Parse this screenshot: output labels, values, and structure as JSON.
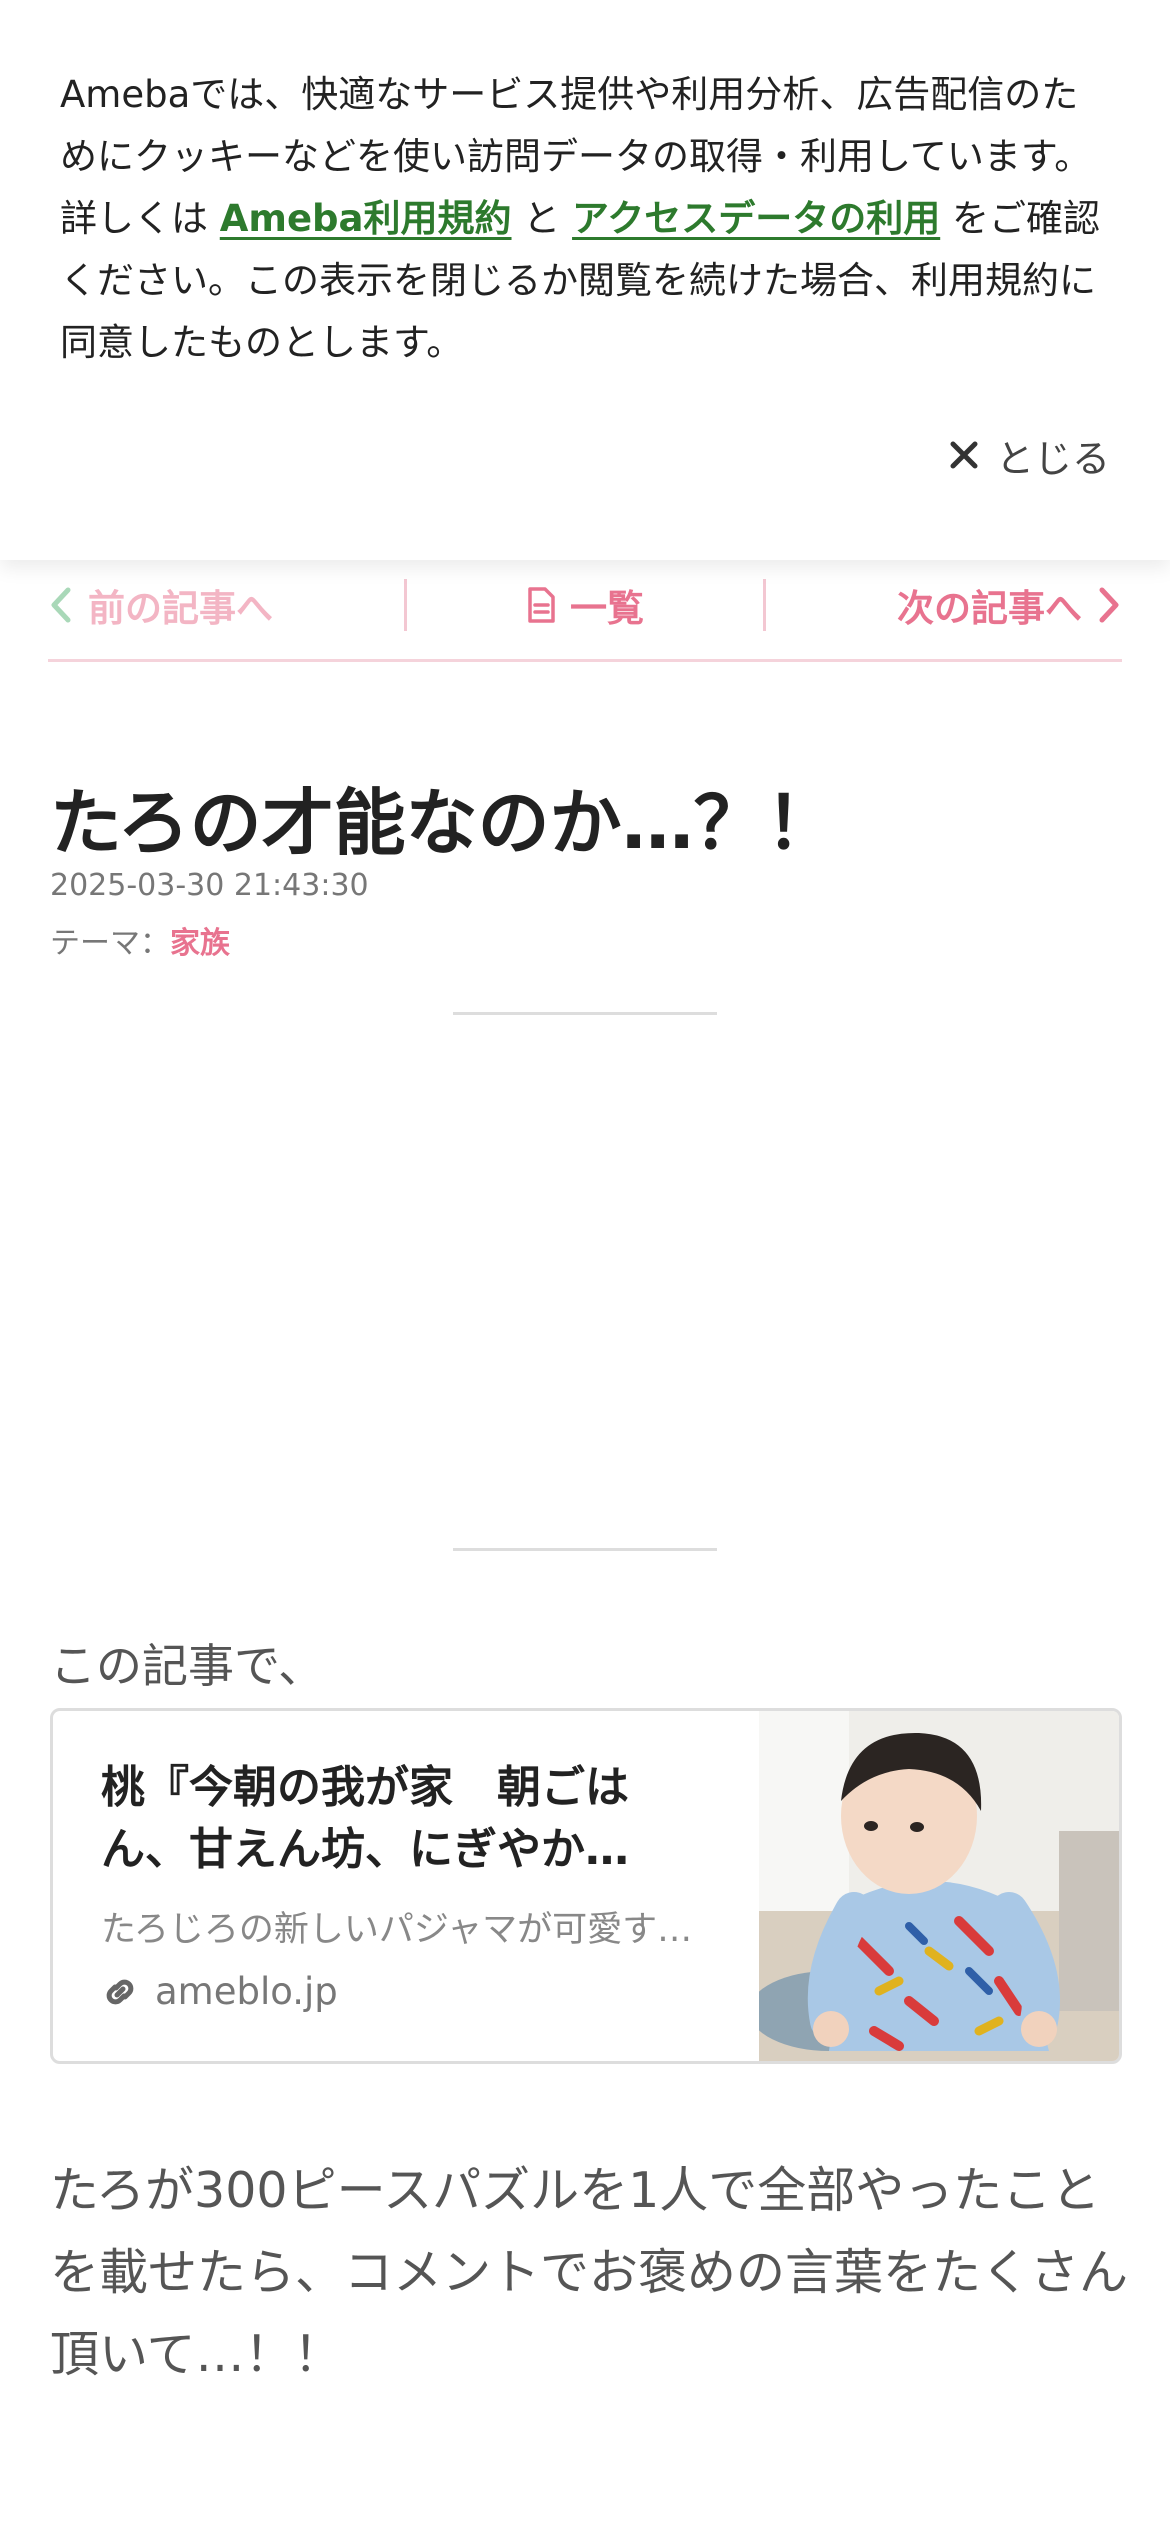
{
  "cookie": {
    "text_before": "Amebaでは、快適なサービス提供や利用分析、広告配信のためにクッキーなどを使い訪問データの取得・利用しています。詳しくは",
    "link_terms": "Ameba利用規約",
    "connector": "と",
    "link_access": "アクセスデータの利用",
    "text_after": "をご確認ください。この表示を閉じるか閲覧を続けた場合、利用規約に同意したものとします。",
    "close_label": "とじる"
  },
  "nav": {
    "prev_label": "前の記事へ",
    "list_label": "一覧",
    "next_label": "次の記事へ"
  },
  "article": {
    "title": "たろの才能なのか…？！",
    "date": "2025-03-30 21:43:30",
    "theme_prefix": "テーマ：",
    "theme": "家族",
    "intro": "この記事で、",
    "body": "たろが300ピースパズルを1人で全部やったことを載せたら、コメントでお褒めの言葉をたくさん頂いて…！！"
  },
  "card": {
    "title": "桃『今朝の我が家　朝ごはん、甘えん坊、にぎやか…",
    "description": "たろじろの新しいパジャマが可愛す…",
    "domain": "ameblo.jp"
  },
  "colors": {
    "accent_pink": "#e8738f",
    "link_green": "#2d7a2d"
  }
}
